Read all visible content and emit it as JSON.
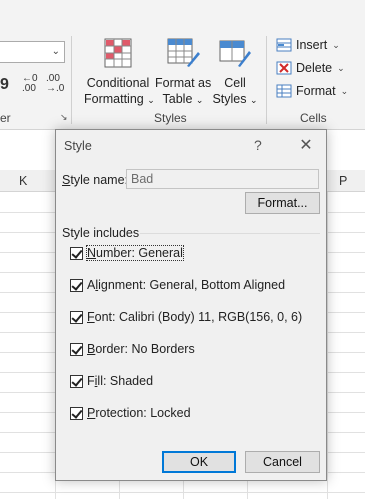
{
  "ribbon": {
    "number_group_label": "er",
    "styles_group_label": "Styles",
    "cells_group_label": "Cells",
    "conditional_formatting": {
      "line1": "Conditional",
      "line2": "Formatting"
    },
    "format_as_table": {
      "line1": "Format as",
      "line2": "Table"
    },
    "cell_styles": {
      "line1": "Cell",
      "line2": "Styles"
    },
    "insert_label": "Insert",
    "delete_label": "Delete",
    "format_label": "Format",
    "increase_decimal": {
      "top": "←0",
      "bottom": ".00"
    },
    "decrease_decimal": {
      "top": ".00",
      "bottom": "→.0"
    }
  },
  "sheet": {
    "columns": [
      "K",
      "P"
    ]
  },
  "dialog": {
    "title": "Style",
    "help": "?",
    "style_name_label_u": "S",
    "style_name_label_rest": "tyle name:",
    "style_name_value": "Bad",
    "format_button": "Format...",
    "style_includes_label": "Style includes",
    "options": [
      {
        "u": "N",
        "rest": "umber: General",
        "checked": true
      },
      {
        "pre": "A",
        "u": "l",
        "rest": "ignment: General, Bottom Aligned",
        "checked": true
      },
      {
        "u": "F",
        "rest": "ont: Calibri (Body) 11, RGB(156, 0, 6)",
        "checked": true
      },
      {
        "u": "B",
        "rest": "order: No Borders",
        "checked": true
      },
      {
        "pre": "F",
        "u": "i",
        "rest": "ll: Shaded",
        "checked": true
      },
      {
        "u": "P",
        "rest": "rotection: Locked",
        "checked": true
      }
    ],
    "ok_label": "OK",
    "cancel_label": "Cancel"
  }
}
